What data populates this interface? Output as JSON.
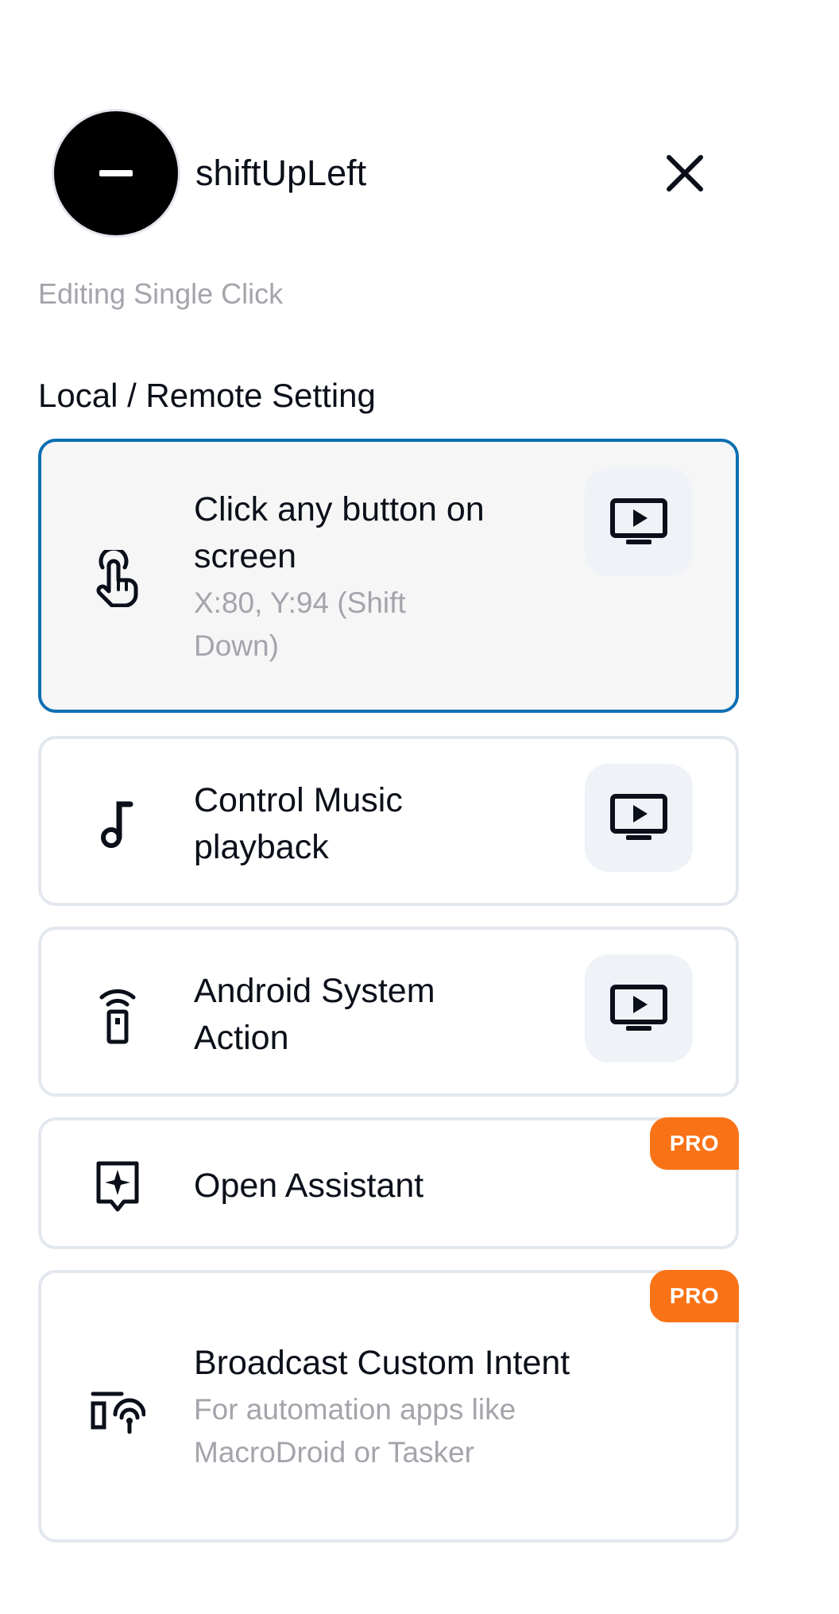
{
  "header": {
    "title": "shiftUpLeft",
    "avatar_icon": "minus-icon",
    "close_icon": "close-icon"
  },
  "subtitle": "Editing Single Click",
  "section_title": "Local / Remote Setting",
  "colors": {
    "selected_border": "#0d6fb3",
    "card_border": "#e3e8ef",
    "pro_badge": "#f97316",
    "muted_text": "#a3a5ab",
    "preview_bg": "#eff3f8"
  },
  "options": [
    {
      "title": "Click any button on screen",
      "description": "X:80, Y:94 (Shift Down)",
      "icon": "tap-icon",
      "selected": true,
      "has_preview": true
    },
    {
      "title": "Control Music playback",
      "icon": "music-note-icon",
      "selected": false,
      "has_preview": true
    },
    {
      "title": "Android System Action",
      "icon": "remote-icon",
      "selected": false,
      "has_preview": true
    },
    {
      "title": "Open Assistant",
      "icon": "assistant-icon",
      "selected": false,
      "badge": "PRO"
    },
    {
      "title": "Broadcast Custom Intent",
      "description": "For automation apps like MacroDroid or Tasker",
      "icon": "broadcast-icon",
      "selected": false,
      "badge": "PRO"
    }
  ],
  "preview_icon": "play-screen-icon"
}
